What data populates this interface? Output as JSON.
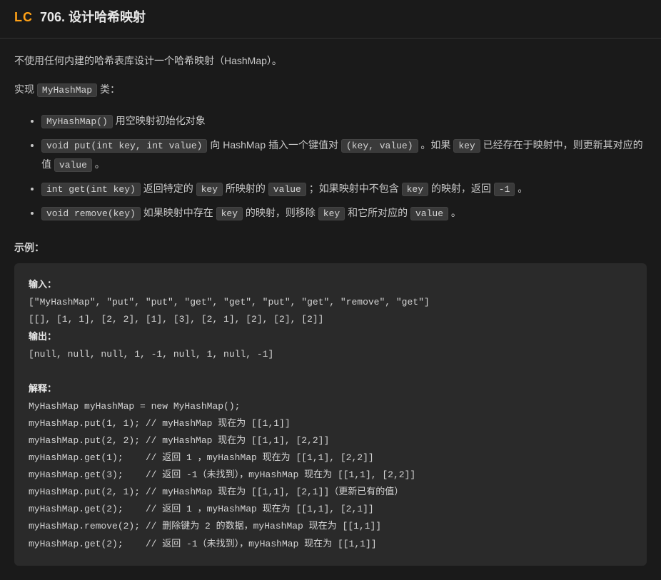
{
  "header": {
    "badge": "LC",
    "title": "706. 设计哈希映射"
  },
  "description": {
    "intro": "不使用任何内建的哈希表库设计一个哈希映射（HashMap）。",
    "implement_prefix": "实现 ",
    "implement_class": "MyHashMap",
    "implement_suffix": " 类："
  },
  "methods": {
    "m1_code": "MyHashMap()",
    "m1_desc": " 用空映射初始化对象",
    "m2_code": "void put(int key, int value)",
    "m2_desc_a": " 向 HashMap 插入一个键值对 ",
    "m2_kv": "(key, value)",
    "m2_desc_b": " 。如果 ",
    "m2_key": "key",
    "m2_desc_c": " 已经存在于映射中，则更新其对应的值 ",
    "m2_value": "value",
    "m2_desc_d": " 。",
    "m3_code": "int get(int key)",
    "m3_desc_a": " 返回特定的 ",
    "m3_key": "key",
    "m3_desc_b": " 所映射的 ",
    "m3_value": "value",
    "m3_desc_c": " ；如果映射中不包含 ",
    "m3_key2": "key",
    "m3_desc_d": " 的映射，返回 ",
    "m3_neg1": "-1",
    "m3_desc_e": " 。",
    "m4_code": "void remove(key)",
    "m4_desc_a": " 如果映射中存在 ",
    "m4_key": "key",
    "m4_desc_b": " 的映射，则移除 ",
    "m4_key2": "key",
    "m4_desc_c": " 和它所对应的 ",
    "m4_value": "value",
    "m4_desc_d": " 。"
  },
  "example": {
    "label": "示例：",
    "input_label": "输入：",
    "input_line1": "[\"MyHashMap\", \"put\", \"put\", \"get\", \"get\", \"put\", \"get\", \"remove\", \"get\"]",
    "input_line2": "[[], [1, 1], [2, 2], [1], [3], [2, 1], [2], [2], [2]]",
    "output_label": "输出：",
    "output_line": "[null, null, null, 1, -1, null, 1, null, -1]",
    "explain_label": "解释：",
    "explain_lines": "MyHashMap myHashMap = new MyHashMap();\nmyHashMap.put(1, 1); // myHashMap 现在为 [[1,1]]\nmyHashMap.put(2, 2); // myHashMap 现在为 [[1,1], [2,2]]\nmyHashMap.get(1);    // 返回 1 ，myHashMap 现在为 [[1,1], [2,2]]\nmyHashMap.get(3);    // 返回 -1（未找到），myHashMap 现在为 [[1,1], [2,2]]\nmyHashMap.put(2, 1); // myHashMap 现在为 [[1,1], [2,1]]（更新已有的值）\nmyHashMap.get(2);    // 返回 1 ，myHashMap 现在为 [[1,1], [2,1]]\nmyHashMap.remove(2); // 删除键为 2 的数据，myHashMap 现在为 [[1,1]]\nmyHashMap.get(2);    // 返回 -1（未找到），myHashMap 现在为 [[1,1]]"
  }
}
